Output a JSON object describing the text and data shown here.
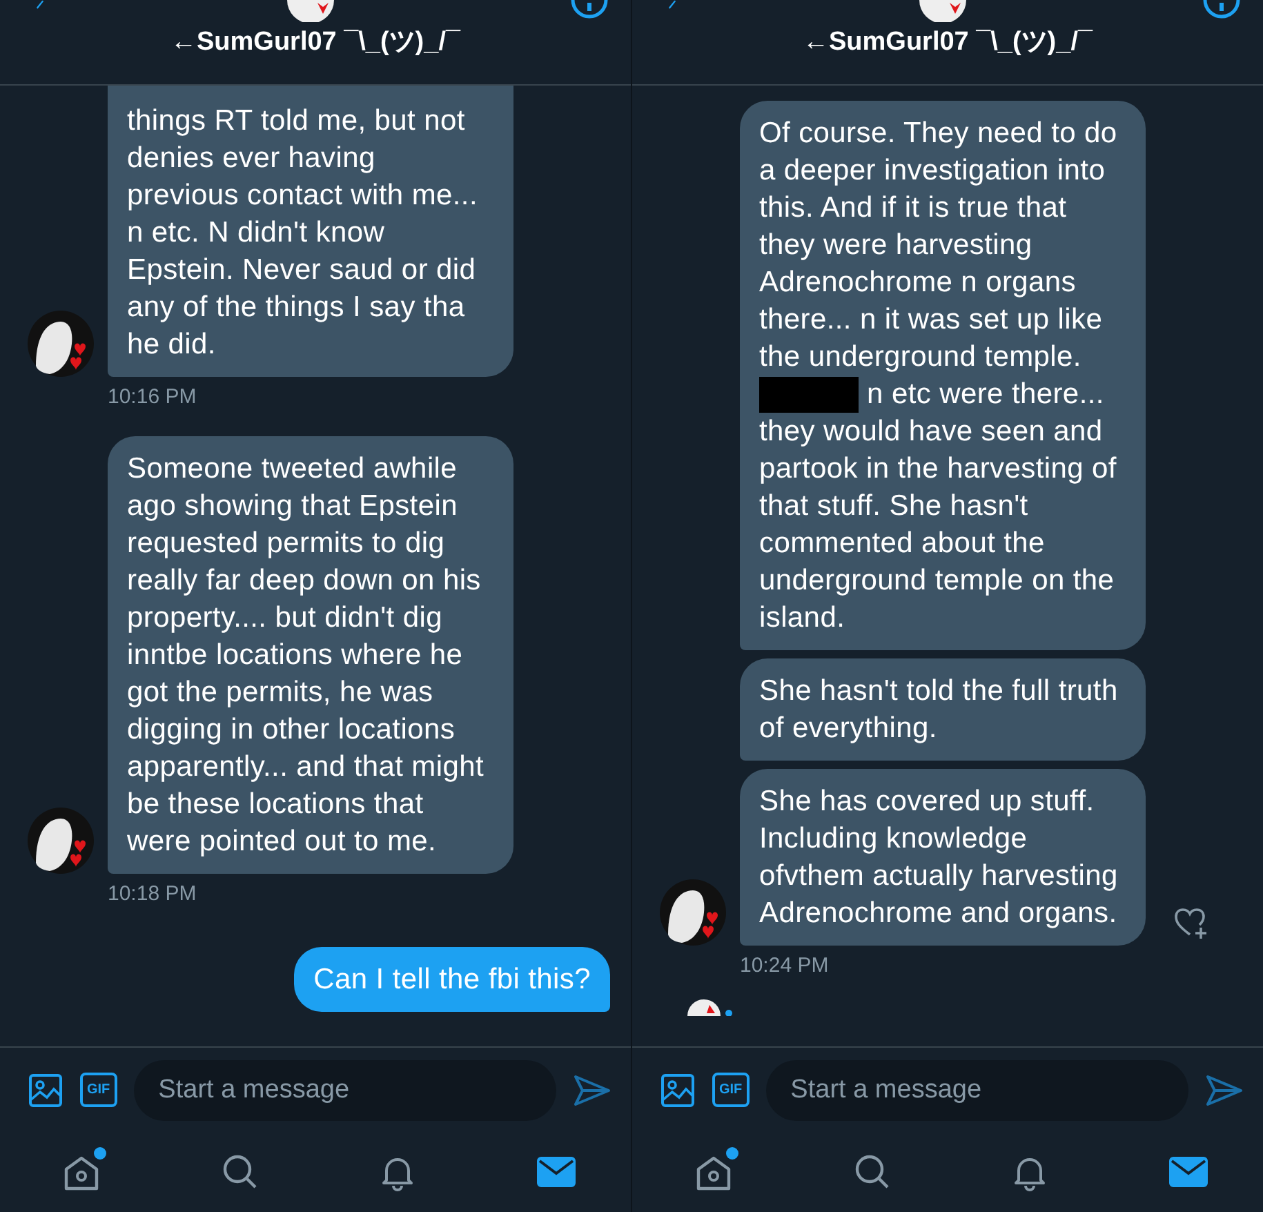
{
  "panels": [
    {
      "header": {
        "title": "←SumGurl07 ¯\\_(ツ)_/¯"
      },
      "groups": [
        {
          "kind": "received",
          "cut_top": true,
          "time": "10:16 PM",
          "bubbles": [
            {
              "parts": [
                {
                  "kind": "text",
                  "text": "things RT told me, but not denies ever having previous contact with me... n etc. N didn't know Epstein. Never saud or did any of the things I say tha he did."
                }
              ]
            }
          ]
        },
        {
          "kind": "received",
          "time": "10:18 PM",
          "bubbles": [
            {
              "parts": [
                {
                  "kind": "text",
                  "text": "Someone tweeted awhile ago showing that Epstein requested permits to dig really far deep down on his property.... but didn't dig inntbe locations where he got the permits, he was digging in other locations apparently... and that might be these locations that were pointed out to me."
                }
              ]
            }
          ]
        },
        {
          "kind": "sent",
          "bubbles": [
            {
              "parts": [
                {
                  "kind": "text",
                  "text": "Can I tell the fbi this?"
                }
              ]
            }
          ]
        }
      ],
      "composer": {
        "placeholder": "Start a message",
        "gif": "GIF"
      },
      "nav": [
        {
          "kind": "home",
          "badge": true,
          "selected": false
        },
        {
          "kind": "search",
          "selected": false
        },
        {
          "kind": "bell",
          "selected": false
        },
        {
          "kind": "mail",
          "selected": true
        }
      ]
    },
    {
      "header": {
        "title": "←SumGurl07 ¯\\_(ツ)_/¯"
      },
      "typing": true,
      "groups": [
        {
          "kind": "received",
          "like_button": true,
          "time": "10:24 PM",
          "bubbles": [
            {
              "parts": [
                {
                  "kind": "text",
                  "text": "Of course. They need to do a deeper investigation into this. And if it is true that they were harvesting Adrenochrome n organs there... n it was set up like the underground temple. "
                },
                {
                  "kind": "redaction"
                },
                {
                  "kind": "text",
                  "text": " n etc were there... they would have seen and partook in the harvesting of that stuff. She hasn't commented about the underground temple on the island."
                }
              ]
            },
            {
              "parts": [
                {
                  "kind": "text",
                  "text": "She hasn't told the full truth of everything."
                }
              ]
            },
            {
              "parts": [
                {
                  "kind": "text",
                  "text": "She has covered up stuff. Including knowledge ofvthem actually harvesting Adrenochrome and organs."
                }
              ]
            }
          ]
        }
      ],
      "composer": {
        "placeholder": "Start a message",
        "gif": "GIF"
      },
      "nav": [
        {
          "kind": "home",
          "badge": true,
          "selected": false
        },
        {
          "kind": "search",
          "selected": false
        },
        {
          "kind": "bell",
          "selected": false
        },
        {
          "kind": "mail",
          "selected": true
        }
      ]
    }
  ]
}
